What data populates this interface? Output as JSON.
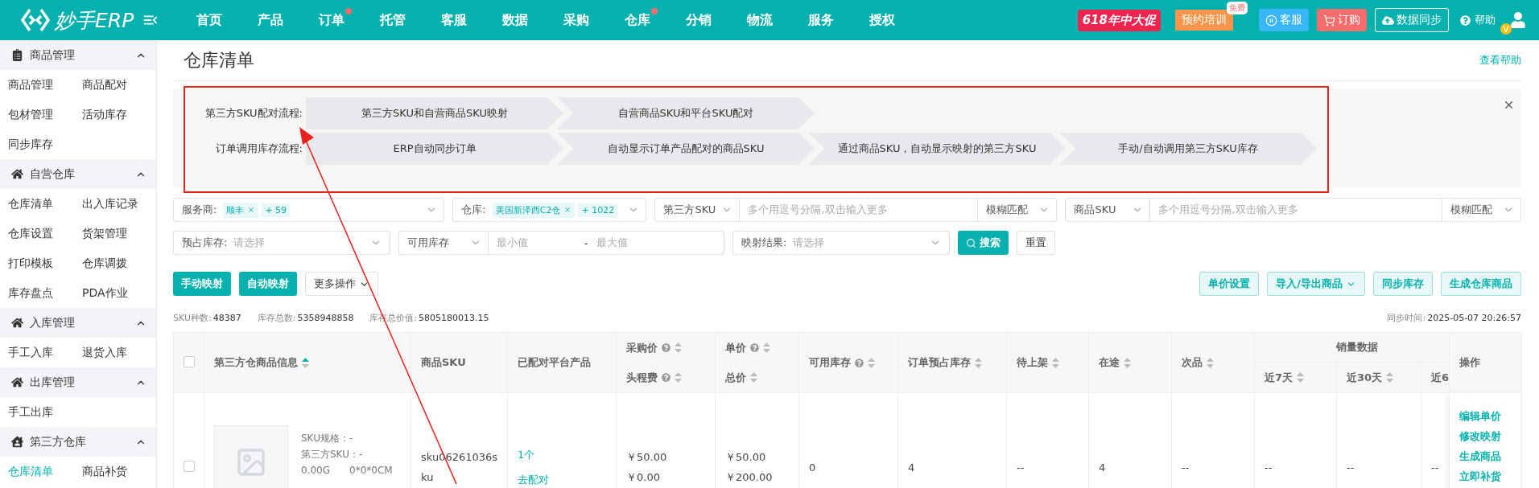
{
  "header": {
    "logo_text": "妙手ERP",
    "nav": [
      {
        "label": "首页",
        "dot": false
      },
      {
        "label": "产品",
        "dot": false
      },
      {
        "label": "订单",
        "dot": true
      },
      {
        "label": "托管",
        "dot": false
      },
      {
        "label": "客服",
        "dot": false
      },
      {
        "label": "数据",
        "dot": false
      },
      {
        "label": "采购",
        "dot": false
      },
      {
        "label": "仓库",
        "dot": true
      },
      {
        "label": "分销",
        "dot": false
      },
      {
        "label": "物流",
        "dot": false
      },
      {
        "label": "服务",
        "dot": false
      },
      {
        "label": "授权",
        "dot": false
      }
    ],
    "promo": "618年中大促",
    "training": "预约培训",
    "training_badge": "免费",
    "service": "客服",
    "order": "订购",
    "sync": "数据同步",
    "help": "帮助",
    "vip_badge": "V"
  },
  "sidebar": [
    {
      "title": "商品管理",
      "expanded": true,
      "items": [
        {
          "label": "商品管理",
          "selected": false
        },
        {
          "label": "商品配对",
          "selected": false
        },
        {
          "label": "包材管理",
          "selected": false
        },
        {
          "label": "活动库存",
          "selected": false
        },
        {
          "label": "同步库存",
          "selected": false
        }
      ]
    },
    {
      "title": "自营仓库",
      "expanded": true,
      "items": [
        {
          "label": "仓库清单",
          "selected": false
        },
        {
          "label": "出入库记录",
          "selected": false
        },
        {
          "label": "仓库设置",
          "selected": false
        },
        {
          "label": "货架管理",
          "selected": false
        },
        {
          "label": "打印模板",
          "selected": false
        },
        {
          "label": "仓库调拨",
          "selected": false
        },
        {
          "label": "库存盘点",
          "selected": false
        },
        {
          "label": "PDA作业",
          "selected": false
        }
      ]
    },
    {
      "title": "入库管理",
      "expanded": true,
      "items": [
        {
          "label": "手工入库",
          "selected": false
        },
        {
          "label": "退货入库",
          "selected": false
        }
      ]
    },
    {
      "title": "出库管理",
      "expanded": true,
      "items": [
        {
          "label": "手工出库",
          "selected": false
        }
      ]
    },
    {
      "title": "第三方仓库",
      "expanded": true,
      "items": [
        {
          "label": "仓库清单",
          "selected": true
        },
        {
          "label": "商品补货",
          "selected": false
        }
      ]
    }
  ],
  "page": {
    "title": "仓库清单",
    "help_link": "查看帮助"
  },
  "flows": [
    {
      "label": "第三方SKU配对流程:",
      "steps": [
        "第三方SKU和自营商品SKU映射",
        "自营商品SKU和平台SKU配对"
      ]
    },
    {
      "label": "订单调用库存流程:",
      "steps": [
        "ERP自动同步订单",
        "自动显示订单产品配对的商品SKU",
        "通过商品SKU，自动显示映射的第三方SKU",
        "手动/自动调用第三方SKU库存"
      ]
    }
  ],
  "filter_rows": [
    [
      {
        "kind": "tags",
        "label": "服务商:",
        "tags": [
          "顺丰"
        ],
        "more": "+ 59"
      },
      {
        "kind": "tags",
        "label": "仓库:",
        "tags": [
          "美国新泽西C2仓"
        ],
        "more": "+ 1022"
      },
      {
        "kind": "search",
        "select": "第三方SKU",
        "placeholder": "多个用逗号分隔,双击输入更多",
        "match": "模糊匹配"
      },
      {
        "kind": "search",
        "select": "商品SKU",
        "placeholder": "多个用逗号分隔,双击输入更多",
        "match": "模糊匹配"
      }
    ],
    [
      {
        "kind": "select",
        "label": "预占库存:",
        "placeholder": "请选择"
      },
      {
        "kind": "range",
        "select": "可用库存",
        "min_placeholder": "最小值",
        "separator": "-",
        "max_placeholder": "最大值"
      },
      {
        "kind": "select",
        "label": "映射结果:",
        "placeholder": "请选择"
      }
    ]
  ],
  "search_button": "搜索",
  "reset_button": "重置",
  "left_actions": [
    {
      "label": "手动映射",
      "kind": "primary"
    },
    {
      "label": "自动映射",
      "kind": "primary"
    },
    {
      "label": "更多操作",
      "kind": "dropdown"
    }
  ],
  "right_actions": [
    {
      "label": "单价设置",
      "dropdown": false
    },
    {
      "label": "导入/导出商品",
      "dropdown": true
    },
    {
      "label": "同步库存",
      "dropdown": false
    },
    {
      "label": "生成仓库商品",
      "dropdown": false
    }
  ],
  "stats": [
    {
      "label": "SKU种数:",
      "value": "48387"
    },
    {
      "label": "库存总数:",
      "value": "5358948858"
    },
    {
      "label": "库存总价值:",
      "value": "5805180013.15"
    }
  ],
  "sync_time": {
    "label": "同步时间:",
    "value": "2025-05-07 20:26:57"
  },
  "table": {
    "select_all": false,
    "header": [
      {
        "kind": "text",
        "label": "第三方仓商品信息",
        "sorted": true
      },
      {
        "kind": "text",
        "label": "商品SKU"
      },
      {
        "kind": "text",
        "label": "已配对平台产品"
      },
      {
        "kind": "double",
        "lines": [
          {
            "label": "采购价",
            "help": true,
            "sorted": false
          },
          {
            "label": "头程费",
            "help": true,
            "sorted": false
          }
        ]
      },
      {
        "kind": "double",
        "lines": [
          {
            "label": "单价",
            "help": true,
            "sorted": false
          },
          {
            "label": "总价",
            "help": false,
            "sorted": false
          }
        ]
      },
      {
        "kind": "text",
        "label": "可用库存",
        "help": true,
        "sorted": false
      },
      {
        "kind": "text",
        "label": "订单预占库存",
        "sorted": false
      },
      {
        "kind": "text",
        "label": "待上架",
        "sorted": false
      },
      {
        "kind": "text",
        "label": "在途",
        "sorted": false
      },
      {
        "kind": "text",
        "label": "次品",
        "sorted": false
      },
      {
        "kind": "group",
        "label": "销量数据",
        "children": [
          {
            "label": "近7天",
            "sorted": false
          },
          {
            "label": "近30天",
            "sorted": false
          },
          {
            "label": "近6"
          }
        ]
      },
      {
        "kind": "text",
        "label": "操作"
      }
    ],
    "rows": [
      {
        "checked": false,
        "spec": "SKU规格：-",
        "third_sku": "第三方SKU：-",
        "weight": "0.00G",
        "size": "0*0*0CM",
        "sku": "sku06261036sku",
        "paired_count": "1个",
        "pair_link": "去配对",
        "purchase_price": "￥50.00",
        "freight": "￥0.00",
        "unit_price": "￥50.00",
        "total_price": "￥200.00",
        "cells": [
          "0",
          "4",
          "--",
          "4",
          "--",
          "--",
          "--",
          "--"
        ],
        "actions": [
          "编辑单价",
          "修改映射",
          "生成商品",
          "立即补货"
        ]
      }
    ]
  }
}
